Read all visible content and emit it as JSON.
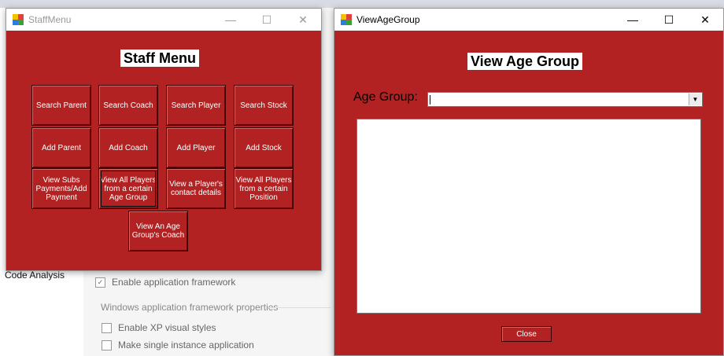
{
  "background": {
    "code_analysis_label": "Code Analysis",
    "enable_framework_label": "Enable application framework",
    "framework_group_label": "Windows application framework properties",
    "xp_styles_label": "Enable XP visual styles",
    "single_instance_label": "Make single instance application"
  },
  "staff_menu": {
    "title": "StaffMenu",
    "heading": "Staff Menu",
    "buttons": [
      "Search Parent",
      "Search Coach",
      "Search Player",
      "Search Stock",
      "Add Parent",
      "Add Coach",
      "Add Player",
      "Add Stock",
      "View Subs Payments/Add Payment",
      "View All Players from a certain Age Group",
      "View a Player's contact details",
      "View All Players from a certain Position",
      "View An Age Group's Coach"
    ]
  },
  "view_age_group": {
    "title": "ViewAgeGroup",
    "heading": "View Age Group",
    "age_group_label": "Age Group:",
    "age_group_value": "",
    "close_label": "Close"
  },
  "window_controls": {
    "minimize": "—",
    "maximize": "☐",
    "close": "✕"
  },
  "colors": {
    "form_background": "#b22222",
    "button_text": "#ffffff"
  }
}
